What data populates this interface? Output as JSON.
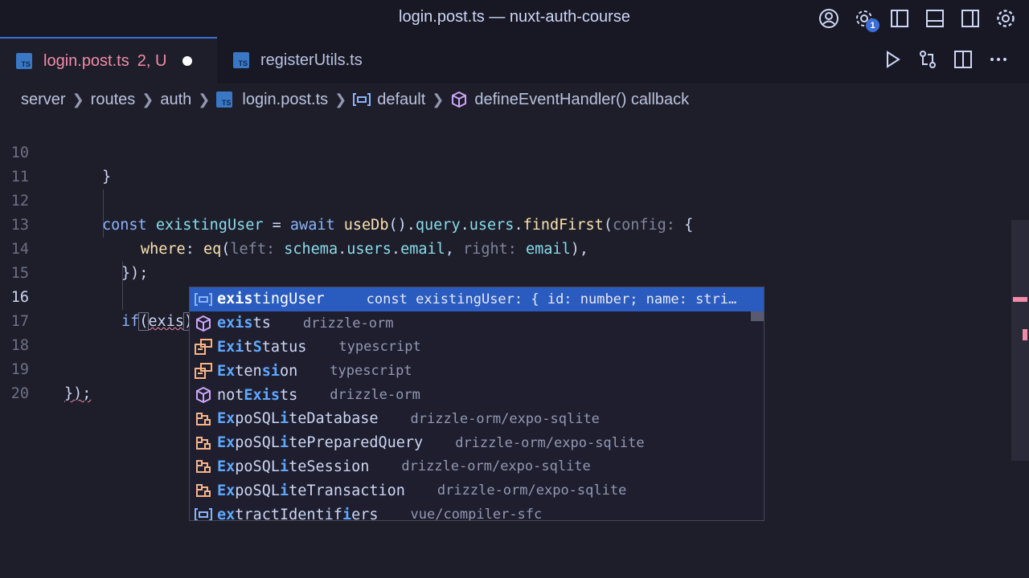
{
  "window": {
    "title": "login.post.ts — nuxt-auth-course"
  },
  "title_actions": {
    "account_icon": "account-circle-icon",
    "manage_icon": "gear-badge-icon",
    "manage_badge": "1",
    "toggle_primary_sidebar_icon": "layout-sidebar-left-icon",
    "toggle_panel_icon": "layout-panel-icon",
    "toggle_secondary_sidebar_icon": "layout-sidebar-right-icon",
    "settings_icon": "gear-icon"
  },
  "tabs": [
    {
      "icon": "TS",
      "label": "login.post.ts",
      "status": "2, U",
      "dirty": true,
      "active": true
    },
    {
      "icon": "TS",
      "label": "registerUtils.ts",
      "active": false
    }
  ],
  "editor_actions": [
    "run-icon",
    "compare-changes-icon",
    "split-editor-icon",
    "more-actions-icon"
  ],
  "breadcrumb": {
    "items": [
      "server",
      "routes",
      "auth",
      "login.post.ts",
      "default",
      "defineEventHandler() callback"
    ]
  },
  "code": {
    "current_line": "16",
    "lines": [
      {
        "num": "10"
      },
      {
        "num": "11"
      },
      {
        "num": "12"
      },
      {
        "num": "13"
      },
      {
        "num": "14"
      },
      {
        "num": "15"
      },
      {
        "num": "16"
      },
      {
        "num": "17"
      },
      {
        "num": "18"
      },
      {
        "num": "19"
      },
      {
        "num": "20"
      }
    ],
    "text": {
      "l10_brace": "}",
      "l12_const": "const",
      "l12_name": "existingUser",
      "l12_eq": " = ",
      "l12_await": "await",
      "l12_useDb": "useDb",
      "l12_paren": "().",
      "l12_query": "query",
      "l12_dot1": ".",
      "l12_users": "users",
      "l12_dot2": ".",
      "l12_findFirst": "findFirst",
      "l12_open": "(",
      "l12_hint": "config:",
      "l12_brace": " {",
      "l13_where": "where",
      "l13_colon": ": ",
      "l13_eq": "eq",
      "l13_open": "(",
      "l13_hint_left": "left:",
      "l13_schema": "schema",
      "l13_dot1": ".",
      "l13_users": "users",
      "l13_dot2": ".",
      "l13_email": "email",
      "l13_comma": ", ",
      "l13_hint_right": "right:",
      "l13_email2": "email",
      "l13_close": "),",
      "l14": "});",
      "l16_if": "if",
      "l16_open": "(",
      "l16_exis": "exis",
      "l16_close": ")",
      "l19": "});"
    }
  },
  "suggestions": [
    {
      "icon": "variable-icon",
      "pre": "",
      "m1": "exis",
      "mid": "",
      "m2": "",
      "rest": "tingUser",
      "detail": "const existingUser: { id: number; name: strin…",
      "selected": true
    },
    {
      "icon": "method-icon",
      "pre": "",
      "m1": "exis",
      "mid": "",
      "m2": "",
      "rest": "ts",
      "detail": "drizzle-orm"
    },
    {
      "icon": "enum-icon",
      "pre": "",
      "m1": "Exi",
      "mid": "t",
      "m2": "S",
      "rest": "tatus",
      "detail": "typescript"
    },
    {
      "icon": "enum-icon",
      "pre": "",
      "m1": "Ex",
      "mid": "ten",
      "m2": "si",
      "rest": "on",
      "detail": "typescript"
    },
    {
      "icon": "method-icon",
      "pre": "not",
      "m1": "Exis",
      "mid": "",
      "m2": "",
      "rest": "ts",
      "detail": "drizzle-orm"
    },
    {
      "icon": "class-icon",
      "pre": "",
      "m1": "Ex",
      "mid": "poSQL",
      "m2": "i",
      "rest": "teDatabase",
      "detail": "drizzle-orm/expo-sqlite"
    },
    {
      "icon": "class-icon",
      "pre": "",
      "m1": "Ex",
      "mid": "poSQL",
      "m2": "i",
      "rest": "tePreparedQuery",
      "detail": "drizzle-orm/expo-sqlite"
    },
    {
      "icon": "class-icon",
      "pre": "",
      "m1": "Ex",
      "mid": "poSQL",
      "m2": "i",
      "rest": "teSession",
      "detail": "drizzle-orm/expo-sqlite"
    },
    {
      "icon": "class-icon",
      "pre": "",
      "m1": "Ex",
      "mid": "poSQL",
      "m2": "i",
      "rest": "teTransaction",
      "detail": "drizzle-orm/expo-sqlite"
    },
    {
      "icon": "variable-icon",
      "pre": "",
      "m1": "ex",
      "mid": "tractIdentif",
      "m2": "i",
      "rest": "ers",
      "detail": "vue/compiler-sfc"
    }
  ],
  "colors": {
    "accent": "#3a6fd8",
    "error": "#f38ba8",
    "background": "#1e1e2a"
  }
}
